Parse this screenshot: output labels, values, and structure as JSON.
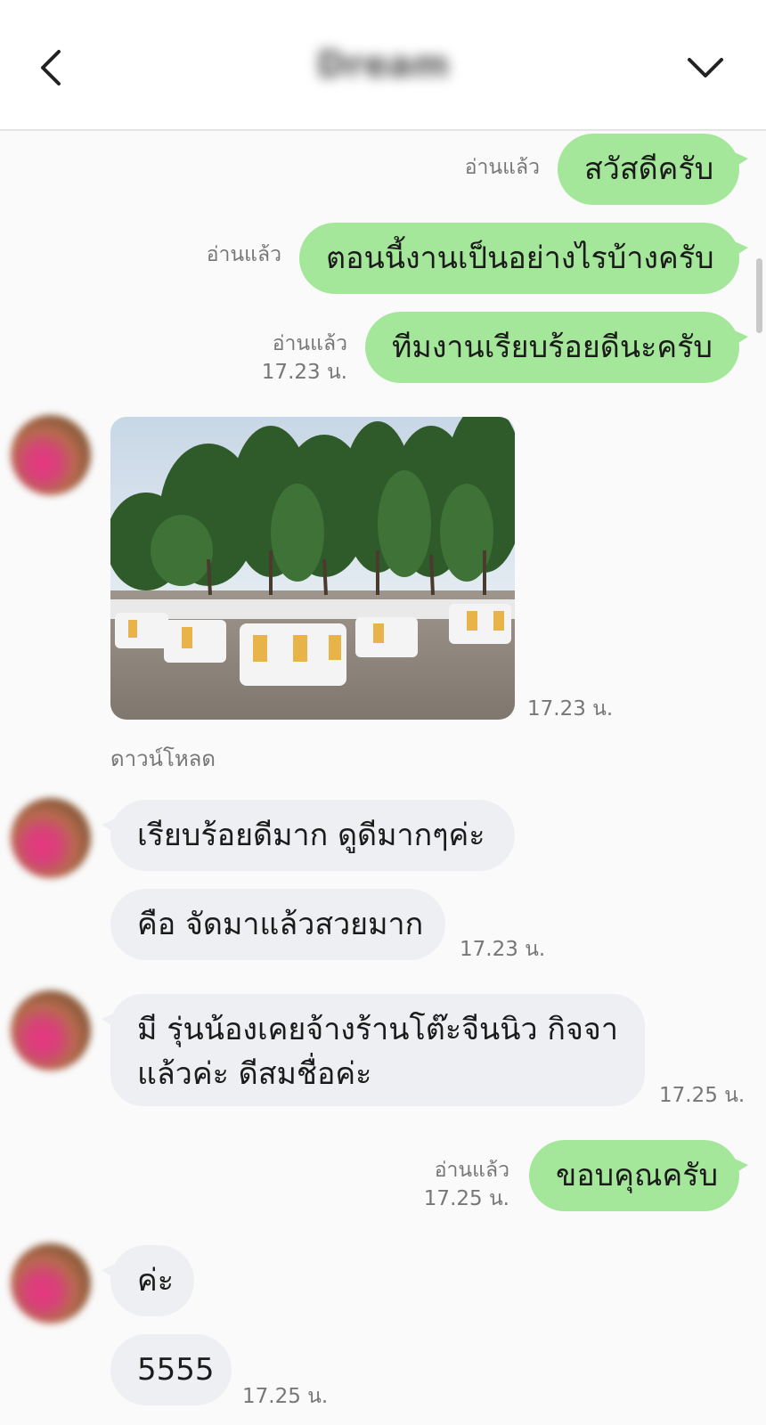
{
  "header": {
    "title": "Dream"
  },
  "messages": [
    {
      "id": "m1",
      "direction": "out",
      "text": "สวัสดีครับ",
      "read": "อ่านแล้ว"
    },
    {
      "id": "m2",
      "direction": "out",
      "text": "ตอนนี้งานเป็นอย่างไรบ้างครับ",
      "read": "อ่านแล้ว"
    },
    {
      "id": "m3",
      "direction": "out",
      "text": "ทีมงานเรียบร้อยดีนะครับ",
      "read": "อ่านแล้ว",
      "time": "17.23 น."
    },
    {
      "id": "m4",
      "direction": "in",
      "type": "image",
      "time": "17.23 น.",
      "download_label": "ดาวน์โหลด"
    },
    {
      "id": "m5",
      "direction": "in",
      "text": "เรียบร้อยดีมาก ดูดีมากๆค่ะ"
    },
    {
      "id": "m6",
      "direction": "in",
      "text": "คือ จัดมาแล้วสวยมาก",
      "time": "17.23 น."
    },
    {
      "id": "m7",
      "direction": "in",
      "text_line1": "มี รุ่นน้องเคยจ้างร้านโต๊ะจีนนิว กิจจา",
      "text_line2": "แล้วค่ะ ดีสมชื่อค่ะ",
      "time": "17.25 น."
    },
    {
      "id": "m8",
      "direction": "out",
      "text": "ขอบคุณครับ",
      "read": "อ่านแล้ว",
      "time": "17.25 น."
    },
    {
      "id": "m9",
      "direction": "in",
      "text": "ค่ะ"
    },
    {
      "id": "m10",
      "direction": "in",
      "text": "5555",
      "time": "17.25 น."
    }
  ],
  "icons": {
    "back": "chevron-left-icon",
    "menu": "chevron-down-icon"
  },
  "colors": {
    "outgoing_bubble": "#a5e79a",
    "incoming_bubble": "#edeff2",
    "background": "#fafafa"
  }
}
